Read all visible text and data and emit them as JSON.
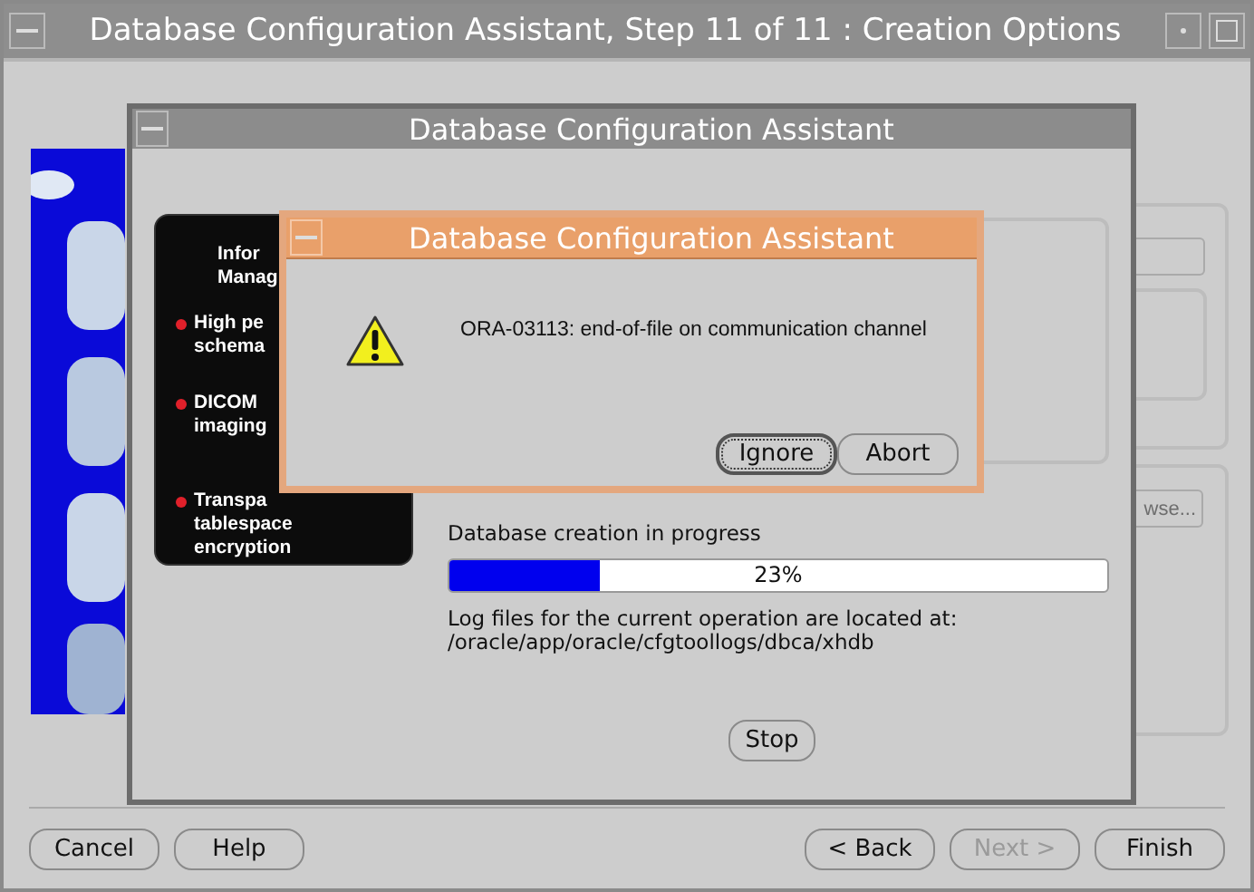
{
  "window": {
    "title": "Database Configuration Assistant, Step 11 of 11 : Creation Options"
  },
  "background": {
    "browse_button": "wse..."
  },
  "progress_window": {
    "title": "Database Configuration Assistant",
    "banner": {
      "heading": [
        "Infor",
        "Manag"
      ],
      "bullets": [
        [
          "High pe",
          "schema"
        ],
        [
          "DICOM",
          "imaging"
        ],
        [
          "Transpa",
          "tablespace",
          "encryption"
        ]
      ]
    },
    "status": "Database creation in progress",
    "progress": {
      "level": 0.23,
      "reading": "23%"
    },
    "log_lines": [
      "Log files for the current operation are located at:",
      "/oracle/app/oracle/cfgtoollogs/dbca/xhdb"
    ],
    "stop_button": "Stop"
  },
  "alert": {
    "title": "Database Configuration Assistant",
    "message": "ORA-03113: end-of-file on communication channel",
    "buttons": [
      {
        "label": "Ignore",
        "focused": true
      },
      {
        "label": "Abort",
        "focused": false
      }
    ]
  },
  "footer": {
    "left_buttons": [
      {
        "label": "Cancel",
        "disabled": false
      },
      {
        "label": "Help",
        "disabled": false
      }
    ],
    "right_buttons": [
      {
        "label": "< Back",
        "disabled": false
      },
      {
        "label": "Next >",
        "disabled": true
      },
      {
        "label": "Finish",
        "disabled": false
      }
    ]
  }
}
